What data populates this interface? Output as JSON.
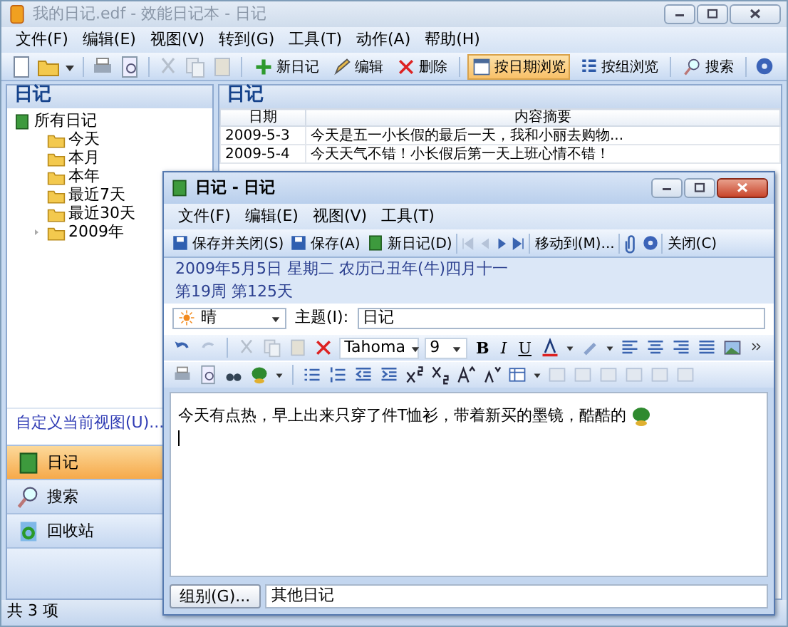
{
  "window": {
    "title": "我的日记.edf - 效能日记本 - 日记"
  },
  "menu": [
    "文件(F)",
    "编辑(E)",
    "视图(V)",
    "转到(G)",
    "工具(T)",
    "动作(A)",
    "帮助(H)"
  ],
  "toolbar": [
    {
      "label": "新日记",
      "selected": false
    },
    {
      "label": "编辑",
      "selected": false
    },
    {
      "label": "删除",
      "selected": false
    },
    {
      "label": "按日期浏览",
      "selected": true
    },
    {
      "label": "按组浏览",
      "selected": false
    },
    {
      "label": "搜索",
      "selected": false
    }
  ],
  "sidebar": {
    "title": "日记",
    "tree": [
      {
        "label": "所有日记",
        "expanded": true,
        "children": [
          {
            "label": "今天"
          },
          {
            "label": "本月"
          },
          {
            "label": "本年"
          },
          {
            "label": "最近7天"
          },
          {
            "label": "最近30天"
          },
          {
            "label": "2009年",
            "expanded": false
          }
        ]
      }
    ],
    "customize_link": "自定义当前视图(U)...",
    "nav": [
      {
        "label": "日记",
        "selected": true
      },
      {
        "label": "搜索",
        "selected": false
      },
      {
        "label": "回收站",
        "selected": false
      }
    ]
  },
  "list": {
    "title": "日记",
    "columns": [
      "日期",
      "内容摘要"
    ],
    "rows": [
      [
        "2009-5-3",
        "今天是五一小长假的最后一天，我和小丽去购物..."
      ],
      [
        "2009-5-4",
        "今天天气不错！小长假后第一天上班心情不错！"
      ]
    ]
  },
  "status_bar": "共 3 项",
  "dialog": {
    "title": "日记 - 日记",
    "menu": [
      "文件(F)",
      "编辑(E)",
      "视图(V)",
      "工具(T)"
    ],
    "toolbar": [
      "保存并关闭(S)",
      "保存(A)",
      "新日记(D)",
      "移动到(M)...",
      "关闭(C)"
    ],
    "date_line": "2009年5月5日 星期二 农历己丑年(牛)四月十一",
    "week_line": "第19周 第125天",
    "weather": "晴",
    "subject_label": "主题(I):",
    "subject": "日记",
    "font": "Tahoma",
    "size": "9",
    "format_buttons": [
      "B",
      "I",
      "U"
    ],
    "body": "今天有点热，早上出来只穿了件T恤衫，带着新买的墨镜，酷酷的",
    "group_button": "组别(G)...",
    "group": "其他日记"
  }
}
